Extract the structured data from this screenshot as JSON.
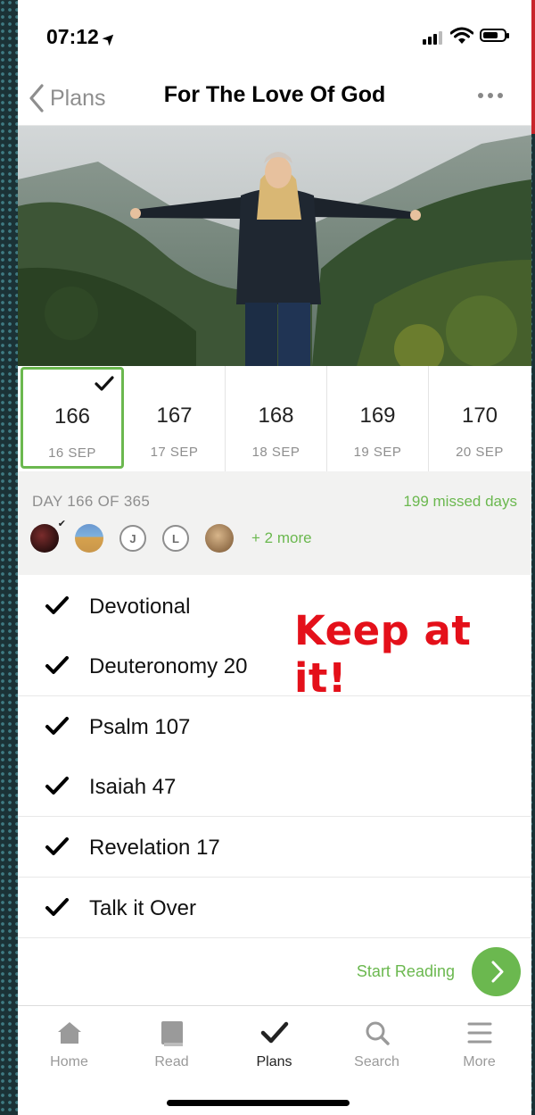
{
  "status": {
    "time": "07:12"
  },
  "nav": {
    "back_label": "Plans",
    "title": "For The Love Of God"
  },
  "days": [
    {
      "num": "166",
      "date": "16 SEP",
      "selected": true,
      "completed": true
    },
    {
      "num": "167",
      "date": "17 SEP"
    },
    {
      "num": "168",
      "date": "18 SEP"
    },
    {
      "num": "169",
      "date": "19 SEP"
    },
    {
      "num": "170",
      "date": "20 SEP"
    }
  ],
  "progress": {
    "day_of": "DAY 166 OF 365",
    "missed": "199 missed days",
    "friend_initials": [
      "J",
      "L"
    ],
    "more_friends": "+ 2 more"
  },
  "readings": [
    {
      "label": "Devotional",
      "done": true
    },
    {
      "label": "Deuteronomy 20",
      "done": true
    },
    {
      "label": "Psalm 107",
      "done": true
    },
    {
      "label": "Isaiah 47",
      "done": true
    },
    {
      "label": "Revelation 17",
      "done": true
    },
    {
      "label": "Talk it Over",
      "done": true
    }
  ],
  "annotation": "Keep at it!",
  "start_reading": "Start Reading",
  "tabs": [
    {
      "label": "Home",
      "icon": "home-icon"
    },
    {
      "label": "Read",
      "icon": "book-icon"
    },
    {
      "label": "Plans",
      "icon": "check-icon",
      "active": true
    },
    {
      "label": "Search",
      "icon": "search-icon"
    },
    {
      "label": "More",
      "icon": "menu-icon"
    }
  ],
  "colors": {
    "accent": "#6bb84f",
    "annotation": "#e4101a"
  }
}
